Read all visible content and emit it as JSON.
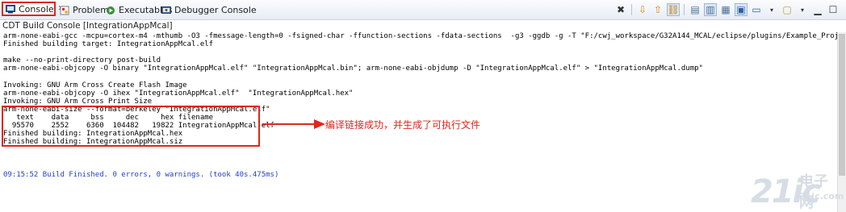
{
  "tabs": [
    {
      "label": "Console",
      "icon": "console-icon"
    },
    {
      "label": "Problems",
      "icon": "problems-icon"
    },
    {
      "label": "Executables",
      "icon": "executables-icon"
    },
    {
      "label": "Debugger Console",
      "icon": "debugger-console-icon"
    }
  ],
  "toolbar_icons": [
    "remove-launch-icon",
    "scroll-down-icon",
    "scroll-up-icon",
    "link-icon",
    "word-wrap-icon",
    "pin-icon",
    "scroll-lock-icon",
    "display-console-icon",
    "new-console-icon",
    "menu-icon",
    "minimize-icon",
    "maximize-icon"
  ],
  "console_title": "CDT Build Console [IntegrationAppMcal]",
  "console_lines": [
    "arm-none-eabi-gcc -mcpu=cortex-m4 -mthumb -O3 -fmessage-length=0 -fsigned-char -ffunction-sections -fdata-sections  -g3 -ggdb -g -T \"F:/cwj_workspace/G32A144_MCAL/eclipse/plugins/Example_Project/IntegrationAppMca",
    "Finished building target: IntegrationAppMcal.elf",
    "",
    "make --no-print-directory post-build",
    "arm-none-eabi-objcopy -O binary \"IntegrationAppMcal.elf\" \"IntegrationAppMcal.bin\"; arm-none-eabi-objdump -D \"IntegrationAppMcal.elf\" > \"IntegrationAppMcal.dump\"",
    "",
    "Invoking: GNU Arm Cross Create Flash Image",
    "arm-none-eabi-objcopy -O ihex \"IntegrationAppMcal.elf\"  \"IntegrationAppMcal.hex\"",
    "Invoking: GNU Arm Cross Print Size",
    "arm-none-eabi-size --format=berkeley \"IntegrationAppMcal.elf\"",
    "   text    data     bss     dec     hex filename",
    "  95570    2552    6360  104482   19822 IntegrationAppMcal.elf",
    "Finished building: IntegrationAppMcal.hex",
    "Finished building: IntegrationAppMcal.siz",
    "",
    "",
    "",
    "09:15:52 Build Finished. 0 errors, 0 warnings. (took 40s.475ms)"
  ],
  "highlight_line_color": "#1f3fd1",
  "annotation": {
    "text": "编译链接成功，并生成了可执行文件",
    "color": "#e0261b"
  },
  "watermark": {
    "main": "21ic",
    "cn": "电子网",
    "sub": "21ic.com"
  }
}
